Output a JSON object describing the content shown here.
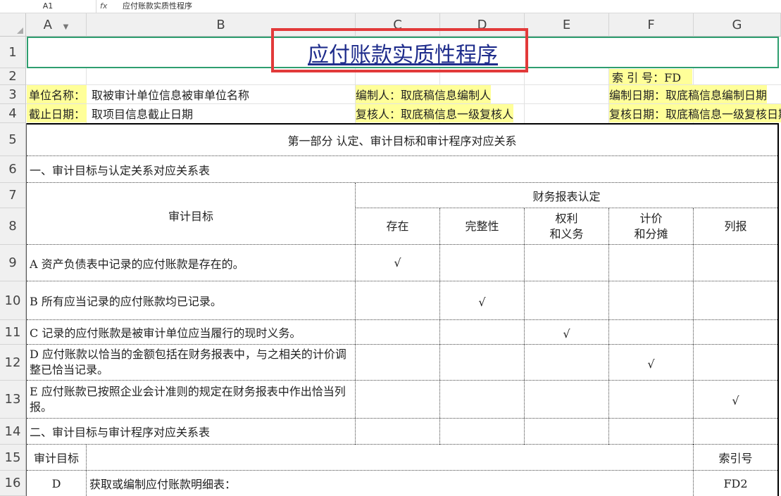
{
  "formula_bar": {
    "cell_ref": "A1",
    "fx": "fx",
    "content": "应付账款实质性程序"
  },
  "columns": [
    {
      "label": "A",
      "has_filter": true
    },
    {
      "label": "B"
    },
    {
      "label": "C"
    },
    {
      "label": "D"
    },
    {
      "label": "E"
    },
    {
      "label": "F"
    },
    {
      "label": "G"
    }
  ],
  "rows": [
    "1",
    "2",
    "3",
    "4",
    "5",
    "6",
    "7",
    "8",
    "9",
    "10",
    "11",
    "12",
    "13",
    "14",
    "15",
    "16"
  ],
  "title": "应付账款实质性程序",
  "index_label": "索 引 号：FD",
  "header_info": {
    "unit_label": "单位名称：",
    "unit_value": "取被审计单位信息被审单位名称",
    "preparer": "编制人：取底稿信息编制人",
    "prep_date": "编制日期：取底稿信息编制日期",
    "cutoff_label": "截止日期：",
    "cutoff_value": "取项目信息截止日期",
    "reviewer": "复核人：取底稿信息一级复核人",
    "review_date": "复核日期：取底稿信息一级复核日期"
  },
  "part1": "第一部分  认定、审计目标和审计程序对应关系",
  "section1": "一、审计目标与认定关系对应关系表",
  "audit_objective_header": "审计目标",
  "assertions_header": "财务报表认定",
  "assertions": [
    "存在",
    "完整性",
    "权利\n和义务",
    "计价\n和分摊",
    "列报"
  ],
  "objectives": [
    {
      "text": "A 资产负债表中记录的应付账款是存在的。",
      "check_col": 0
    },
    {
      "text": "B 所有应当记录的应付账款均已记录。",
      "check_col": 1
    },
    {
      "text": "C 记录的应付账款是被审计单位应当履行的现时义务。",
      "check_col": 2
    },
    {
      "text": "D 应付账款以恰当的金额包括在财务报表中，与之相关的计价调整已恰当记录。",
      "check_col": 3
    },
    {
      "text": "E 应付账款已按照企业会计准则的规定在财务报表中作出恰当列报。",
      "check_col": 4
    }
  ],
  "check_mark": "√",
  "section2": "二、审计目标与审计程序对应关系表",
  "table2": {
    "col_objective": "审计目标",
    "col_index": "索引号"
  },
  "row16": {
    "objective": "D",
    "procedure": "获取或编制应付账款明细表：",
    "index": "FD2"
  }
}
